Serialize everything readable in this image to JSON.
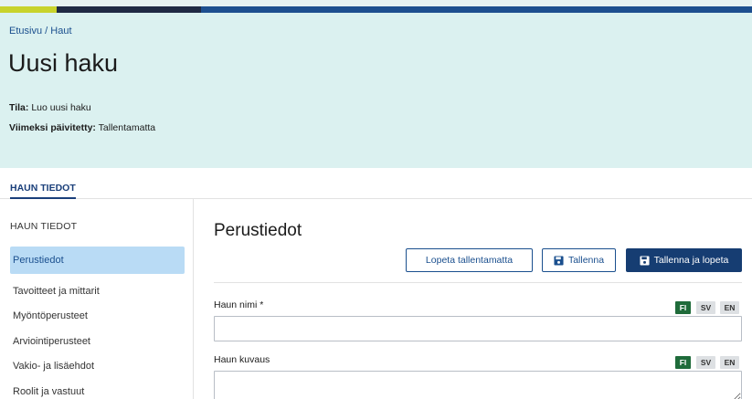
{
  "breadcrumb": {
    "home": "Etusivu",
    "separator": "/",
    "current": "Haut"
  },
  "page": {
    "title": "Uusi haku",
    "status_label": "Tila:",
    "status_value": "Luo uusi haku",
    "updated_label": "Viimeksi päivitetty:",
    "updated_value": "Tallentamatta"
  },
  "tabs": [
    {
      "label": "HAUN TIEDOT",
      "active": true
    }
  ],
  "sidebar": {
    "heading": "HAUN TIEDOT",
    "items": [
      {
        "label": "Perustiedot",
        "active": true
      },
      {
        "label": "Tavoitteet ja mittarit",
        "active": false
      },
      {
        "label": "Myöntöperusteet",
        "active": false
      },
      {
        "label": "Arviointiperusteet",
        "active": false
      },
      {
        "label": "Vakio- ja lisäehdot",
        "active": false
      },
      {
        "label": "Roolit ja vastuut",
        "active": false
      }
    ]
  },
  "main": {
    "section_title": "Perustiedot",
    "buttons": {
      "cancel": "Lopeta tallentamatta",
      "save": "Tallenna",
      "save_and_exit": "Tallenna ja lopeta",
      "save_icon": "floppy-disk-icon"
    },
    "fields": [
      {
        "label": "Haun nimi *",
        "value": "",
        "languages": [
          "FI",
          "SV",
          "EN"
        ],
        "active_language": "FI"
      },
      {
        "label": "Haun kuvaus",
        "value": "",
        "languages": [
          "FI",
          "SV",
          "EN"
        ],
        "active_language": "FI"
      }
    ]
  },
  "colors": {
    "hero_bg": "#dbf1f0",
    "primary": "#163d72",
    "link": "#1a4f8e",
    "active_nav_bg": "#b9dbf5",
    "lang_active": "#1f6b3a",
    "accent_lime": "#c8d32c"
  }
}
